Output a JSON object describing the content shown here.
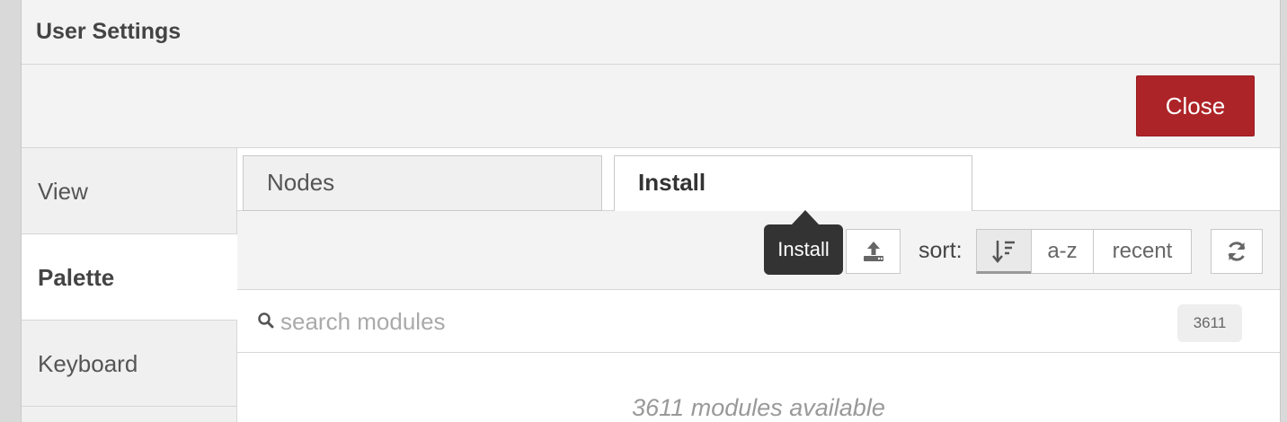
{
  "dialog": {
    "title": "User Settings",
    "close_label": "Close"
  },
  "sidebar": {
    "items": [
      {
        "label": "View",
        "active": false
      },
      {
        "label": "Palette",
        "active": true
      },
      {
        "label": "Keyboard",
        "active": false
      }
    ]
  },
  "tabs": [
    {
      "label": "Nodes",
      "active": false
    },
    {
      "label": "Install",
      "active": true
    }
  ],
  "toolbar": {
    "tooltip": "Install",
    "upload_icon": "upload-icon",
    "sort_label": "sort:",
    "sort_options": [
      {
        "label": "",
        "icon": "sort-relevance-icon",
        "selected": true
      },
      {
        "label": "a-z",
        "selected": false
      },
      {
        "label": "recent",
        "selected": false
      }
    ],
    "refresh_icon": "refresh-icon"
  },
  "search": {
    "placeholder": "search modules",
    "value": "",
    "count": "3611"
  },
  "results": {
    "message": "3611 modules available"
  },
  "colors": {
    "close_button": "#ad2428",
    "tooltip_bg": "#333333"
  }
}
